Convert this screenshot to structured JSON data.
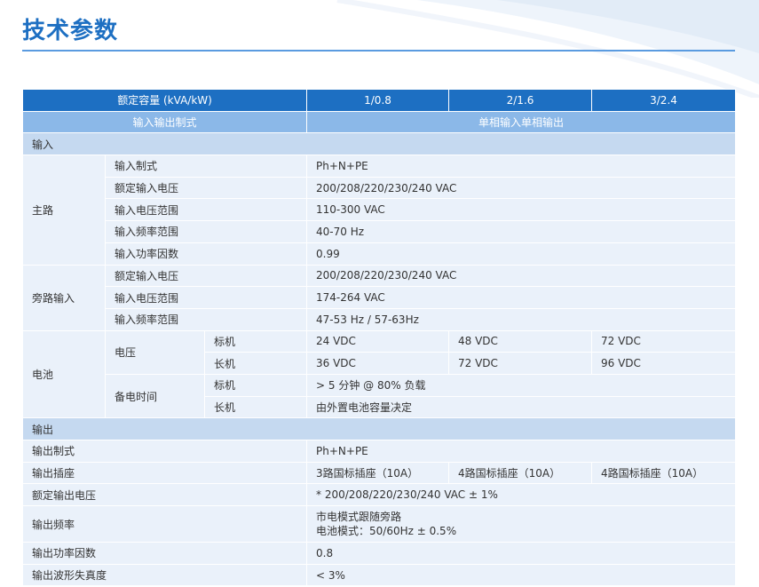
{
  "page_title": "技术参数",
  "header": {
    "capacity_label": "额定容量 (kVA/kW)",
    "models": [
      "1/0.8",
      "2/1.6",
      "3/2.4"
    ],
    "io_label": "输入输出制式",
    "io_value": "单相输入单相输出"
  },
  "input": {
    "section_label": "输入",
    "main": {
      "label": "主路",
      "rows": [
        {
          "name": "输入制式",
          "value": "Ph+N+PE"
        },
        {
          "name": "额定输入电压",
          "value": "200/208/220/230/240 VAC"
        },
        {
          "name": "输入电压范围",
          "value": "110-300 VAC"
        },
        {
          "name": "输入频率范围",
          "value": "40-70 Hz"
        },
        {
          "name": "输入功率因数",
          "value": "0.99"
        }
      ]
    },
    "bypass": {
      "label": "旁路输入",
      "rows": [
        {
          "name": "额定输入电压",
          "value": "200/208/220/230/240 VAC"
        },
        {
          "name": "输入电压范围",
          "value": "174-264 VAC"
        },
        {
          "name": "输入频率范围",
          "value": "47-53 Hz / 57-63Hz"
        }
      ]
    }
  },
  "battery": {
    "label": "电池",
    "voltage_label": "电压",
    "backup_label": "备电时间",
    "standard_label": "标机",
    "long_label": "长机",
    "voltage_standard": [
      "24 VDC",
      "48 VDC",
      "72 VDC"
    ],
    "voltage_long": [
      "36 VDC",
      "72 VDC",
      "96 VDC"
    ],
    "backup_standard": "> 5 分钟 @ 80% 负载",
    "backup_long": "由外置电池容量决定"
  },
  "output": {
    "section_label": "输出",
    "rows": {
      "mode": {
        "name": "输出制式",
        "value": "Ph+N+PE"
      },
      "socket": {
        "name": "输出插座",
        "values": [
          "3路国标插座（10A）",
          "4路国标插座（10A）",
          "4路国标插座（10A）"
        ]
      },
      "voltage": {
        "name": "额定输出电压",
        "value": "* 200/208/220/230/240 VAC ± 1%"
      },
      "frequency": {
        "name": "输出频率",
        "line1": "市电模式跟随旁路",
        "line2": "电池模式：50/60Hz ± 0.5%"
      },
      "pf": {
        "name": "输出功率因数",
        "value": "0.8"
      },
      "thd": {
        "name": "输出波形失真度",
        "value": "< 3%"
      }
    }
  }
}
